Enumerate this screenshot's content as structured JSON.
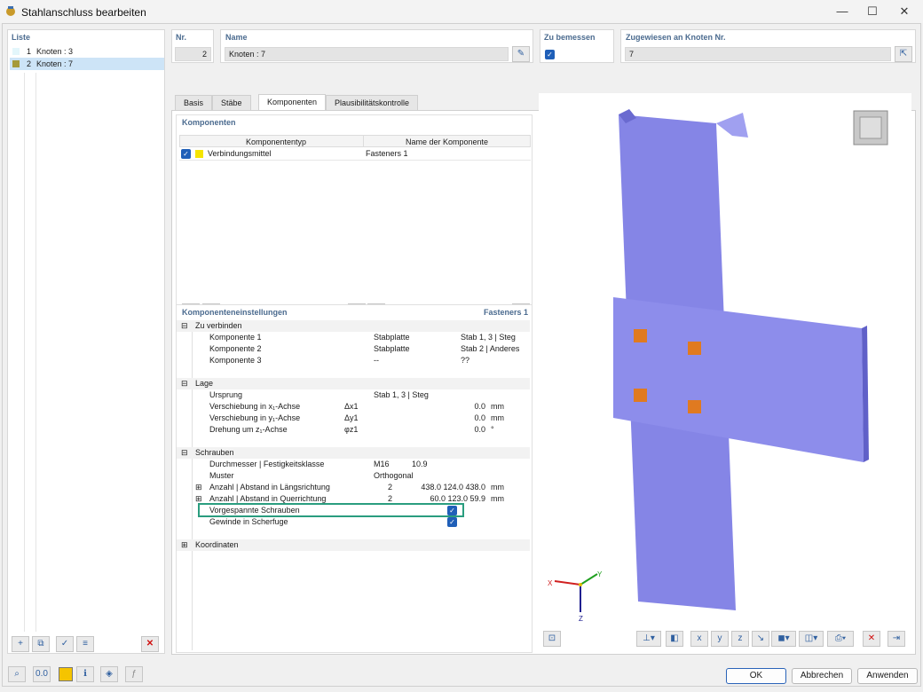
{
  "window": {
    "title": "Stahlanschluss bearbeiten",
    "minimize": "—",
    "maximize": "☐",
    "close": "✕"
  },
  "list": {
    "header": "Liste",
    "items": [
      {
        "num": "1",
        "label": "Knoten : 3",
        "color": "#e3f6fb"
      },
      {
        "num": "2",
        "label": "Knoten : 7",
        "color": "#a59a3a"
      }
    ]
  },
  "fields": {
    "nr_label": "Nr.",
    "nr_value": "2",
    "name_label": "Name",
    "name_value": "Knoten : 7",
    "design_label": "Zu bemessen",
    "assigned_label": "Zugewiesen an Knoten Nr.",
    "assigned_value": "7"
  },
  "tabs": [
    "Basis",
    "Stäbe",
    "Komponenten",
    "Plausibilitätskontrolle"
  ],
  "components": {
    "header": "Komponenten",
    "col1": "Komponententyp",
    "col2": "Name der Komponente",
    "rows": [
      {
        "type": "Verbindungsmittel",
        "name": "Fasteners 1",
        "color": "#f5e400"
      }
    ]
  },
  "settings": {
    "header": "Komponenteneinstellungen",
    "selected": "Fasteners 1",
    "g1": {
      "title": "Zu verbinden",
      "rows": [
        [
          "Komponente 1",
          "",
          "Stabplatte",
          "Stab 1, 3 | Steg"
        ],
        [
          "Komponente 2",
          "",
          "Stabplatte",
          "Stab 2 | Anderes"
        ],
        [
          "Komponente 3",
          "",
          "--",
          "??"
        ]
      ]
    },
    "g2": {
      "title": "Lage",
      "origin_label": "Ursprung",
      "origin_value": "Stab 1, 3 | Steg",
      "rows": [
        [
          "Verschiebung in x₁-Achse",
          "Δx1",
          "0.0",
          "mm"
        ],
        [
          "Verschiebung in y₁-Achse",
          "Δy1",
          "0.0",
          "mm"
        ],
        [
          "Drehung um z₁-Achse",
          "φz1",
          "0.0",
          "°"
        ]
      ]
    },
    "g3": {
      "title": "Schrauben",
      "diam_label": "Durchmesser | Festigkeitsklasse",
      "diam": "M16",
      "grade": "10.9",
      "pattern_label": "Muster",
      "pattern": "Orthogonal",
      "long_label": "Anzahl | Abstand in Längsrichtung",
      "long_n": "2",
      "long_v": "438.0 124.0 438.0",
      "long_u": "mm",
      "cross_label": "Anzahl | Abstand in Querrichtung",
      "cross_n": "2",
      "cross_v": "60.0 123.0 59.9",
      "cross_u": "mm",
      "pre_label": "Vorgespannte Schrauben",
      "thread_label": "Gewinde in Scherfuge"
    },
    "g4": {
      "title": "Koordinaten"
    }
  },
  "axes": {
    "x": "X",
    "y": "Y",
    "z": "Z"
  },
  "buttons": {
    "ok": "OK",
    "cancel": "Abbrechen",
    "apply": "Anwenden"
  },
  "colors": {
    "accent": "#1f5fb8",
    "member": "#8787e8",
    "highlight": "#2a9d7f"
  }
}
